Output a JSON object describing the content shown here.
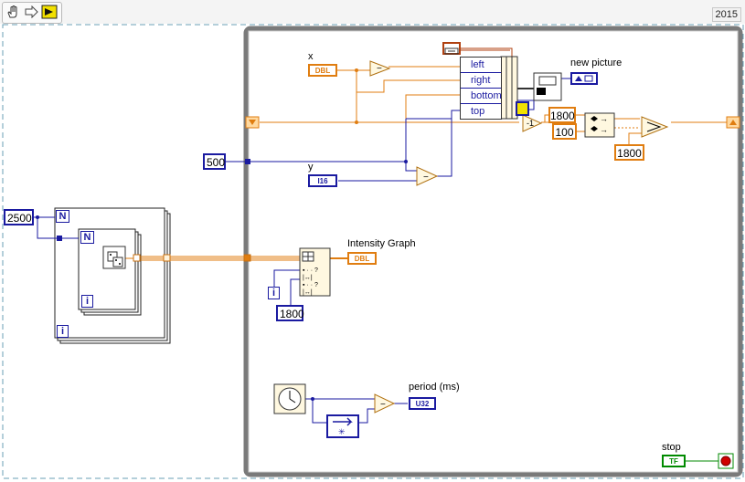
{
  "toolbar": {
    "run_continuously_icon": "hand-pointer-icon",
    "step_icon": "arrow-right-icon",
    "run_icon": "labview-run-icon",
    "version": "2015"
  },
  "constants": {
    "count_outer": "2500",
    "y_offset": "500",
    "intensity_len": "1800",
    "width_a": "1800",
    "height_b": "100",
    "max_c": "1800"
  },
  "labels": {
    "x": "x",
    "y": "y",
    "new_picture": "new picture",
    "intensity_graph": "Intensity Graph",
    "period": "period (ms)",
    "stop": "stop"
  },
  "terminals": {
    "x_type": "DBL",
    "y_type": "I16",
    "intensity_type": "DBL",
    "period_type": "U32",
    "stop_type": "TF",
    "N": "N",
    "i": "i"
  },
  "bundle": {
    "rows": [
      "left",
      "right",
      "bottom",
      "top"
    ]
  },
  "colors": {
    "wire_orange": "#e07d10",
    "wire_blue": "#1a1aa0",
    "loop_border": "#7a7a7a",
    "stop_green": "#008a00",
    "stop_red": "#d00000"
  }
}
